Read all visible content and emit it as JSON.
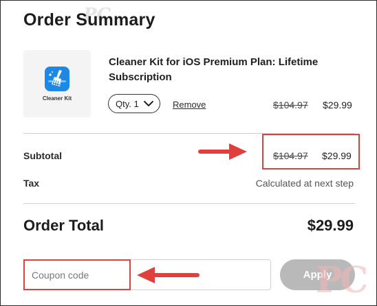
{
  "summary": {
    "title": "Order Summary"
  },
  "watermark": {
    "text": "PC"
  },
  "item": {
    "thumbnail_label": "Cleaner Kit",
    "app_icon": "broom-app-icon",
    "name": "Cleaner Kit for iOS Premium Plan: Lifetime Subscription",
    "qty_label": "Qty. 1",
    "remove_label": "Remove",
    "original_price": "$104.97",
    "price": "$29.99"
  },
  "subtotal": {
    "label": "Subtotal",
    "original_price": "$104.97",
    "price": "$29.99"
  },
  "tax": {
    "label": "Tax",
    "value": "Calculated at next step"
  },
  "total": {
    "label": "Order Total",
    "value": "$29.99"
  },
  "coupon": {
    "placeholder": "Coupon code",
    "apply_label": "Apply"
  },
  "colors": {
    "annotation_red": "#e0403b",
    "apply_button": "#b9b9b9",
    "app_icon_blue": "#1e88e5"
  }
}
